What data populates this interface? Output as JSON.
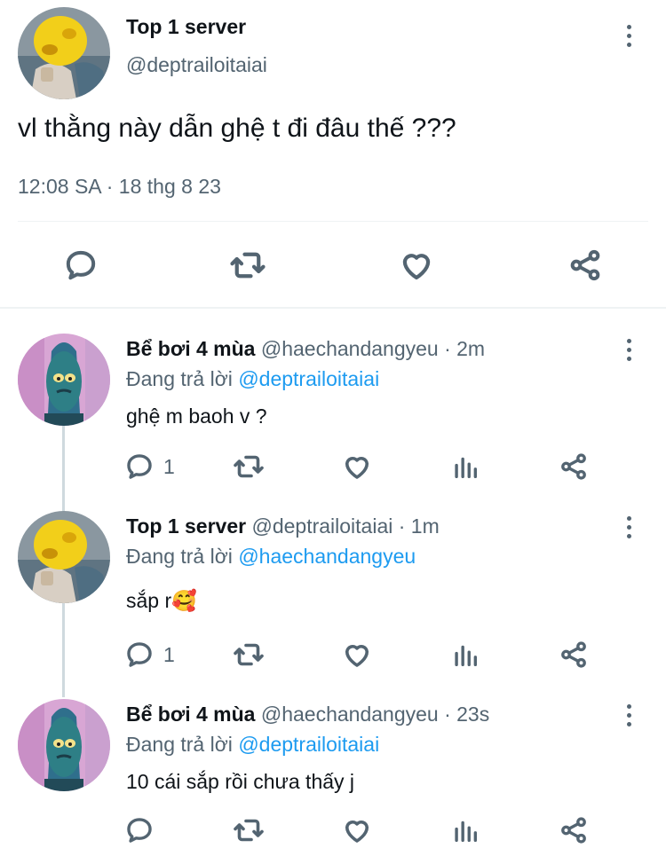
{
  "main_tweet": {
    "display_name": "Top 1 server",
    "handle": "@deptrailoitaiai",
    "text": "vl thằng này dẫn ghệ t đi đâu thế ???",
    "timestamp": "12:08 SA · 18 thg 8 23"
  },
  "replies": [
    {
      "display_name": "Bể bơi 4 mùa",
      "meta": "@haechandangyeu · 2m",
      "replying_prefix": "Đang trả lời",
      "replying_to": "@deptrailoitaiai",
      "text": "ghệ m baoh v ?",
      "reply_count": "1"
    },
    {
      "display_name": "Top 1 server",
      "meta": "@deptrailoitaiai · 1m",
      "replying_prefix": "Đang trả lời",
      "replying_to": "@haechandangyeu",
      "text": "sắp r",
      "emoji": "🥰",
      "reply_count": "1"
    },
    {
      "display_name": "Bể bơi 4 mùa",
      "meta": "@haechandangyeu · 23s",
      "replying_prefix": "Đang trả lời",
      "replying_to": "@deptrailoitaiai",
      "text": "10 cái sắp rồi chưa thấy j",
      "reply_count": ""
    }
  ],
  "icons": {
    "reply": "speech-bubble-icon",
    "retweet": "retweet-arrows-icon",
    "like": "heart-icon",
    "views": "bar-chart-icon",
    "share": "share-nodes-icon",
    "more": "more-vertical-icon"
  },
  "colors": {
    "link": "#1d9bf0",
    "secondary_text": "#536471",
    "divider": "#eff3f4",
    "thread_line": "#cfd9de"
  }
}
